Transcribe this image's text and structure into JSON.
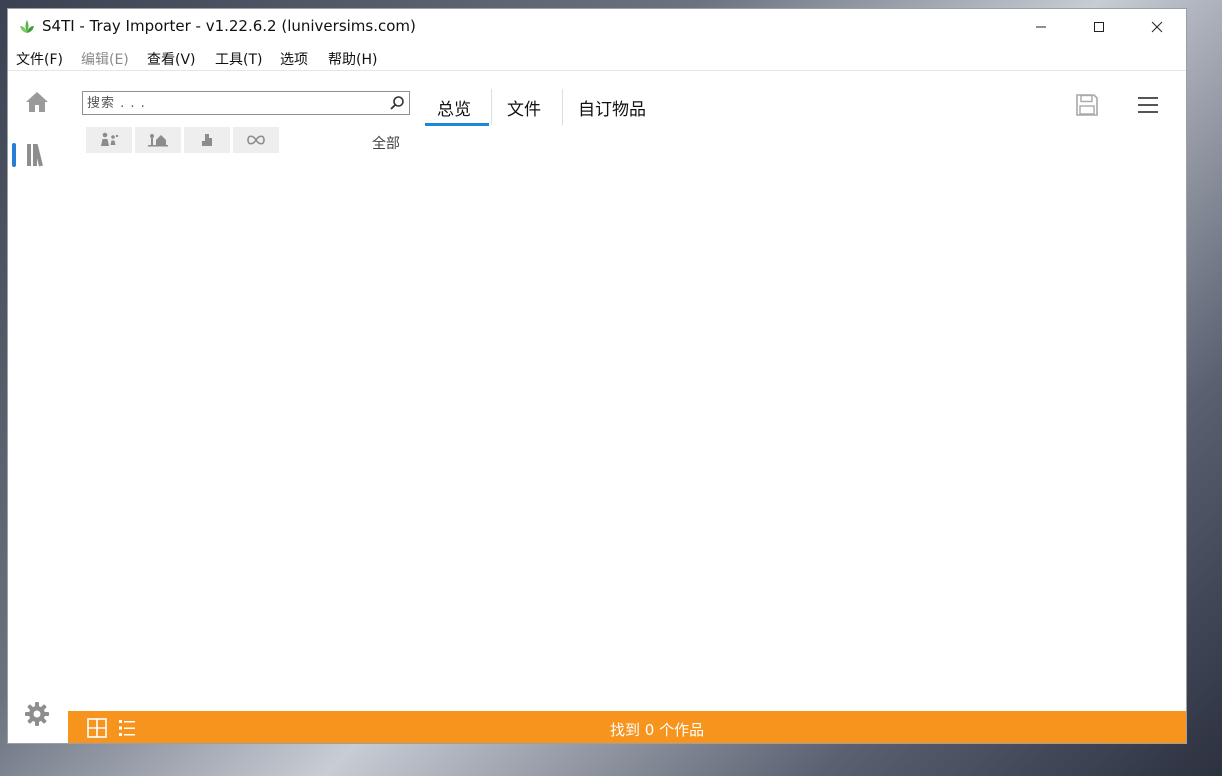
{
  "window": {
    "title": "S4TI - Tray Importer - v1.22.6.2  (luniversims.com)"
  },
  "menu": [
    {
      "label": "文件(F)",
      "enabled": true
    },
    {
      "label": "编辑(E)",
      "enabled": false
    },
    {
      "label": "查看(V)",
      "enabled": true
    },
    {
      "label": "工具(T)",
      "enabled": true
    },
    {
      "label": "选项",
      "enabled": true
    },
    {
      "label": "帮助(H)",
      "enabled": true
    }
  ],
  "search": {
    "placeholder": "搜索 . . ."
  },
  "filters": {
    "buttons": [
      "households-icon",
      "lots-icon",
      "rooms-icon",
      "infinity-icon"
    ],
    "selected_label": "全部"
  },
  "tabs": [
    {
      "label": "总览",
      "active": true
    },
    {
      "label": "文件",
      "active": false
    },
    {
      "label": "自订物品",
      "active": false
    }
  ],
  "status": {
    "text": "找到  0  个作品"
  },
  "colors": {
    "accent": "#1e88d8",
    "status_bar": "#f7941d"
  }
}
